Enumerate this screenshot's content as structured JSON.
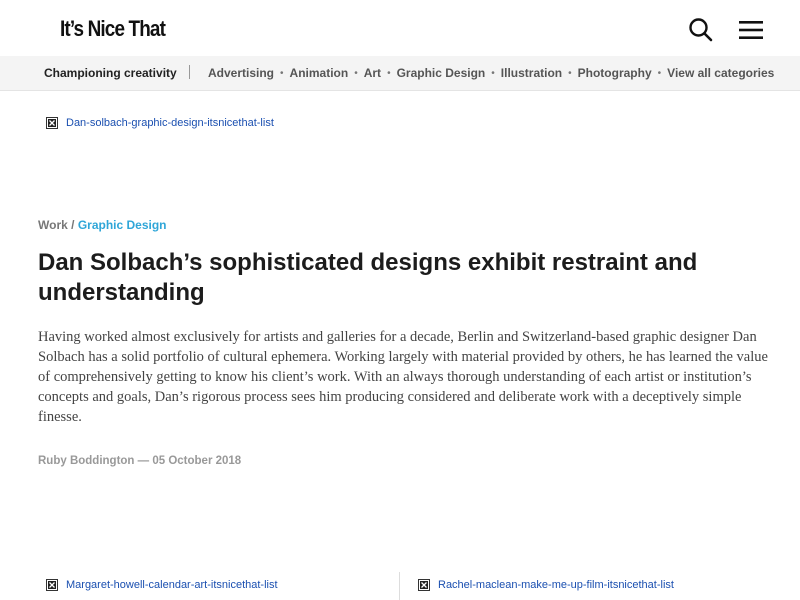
{
  "header": {
    "logo_text": "It’s Nice That",
    "search_icon": "search-icon",
    "menu_icon": "hamburger-menu-icon"
  },
  "nav": {
    "tagline": "Championing creativity",
    "categories": [
      "Advertising",
      "Animation",
      "Art",
      "Graphic Design",
      "Illustration",
      "Photography",
      "View all categories"
    ]
  },
  "hero_image": {
    "alt": "Dan-solbach-graphic-design-itsnicethat-list"
  },
  "article": {
    "breadcrumb_section": "Work",
    "breadcrumb_separator": " / ",
    "breadcrumb_category": "Graphic Design",
    "title": "Dan Solbach’s sophisticated designs exhibit restraint and understanding",
    "intro": "Having worked almost exclusively for artists and galleries for a decade, Berlin and Switzerland-based graphic designer Dan Solbach has a solid portfolio of cultural ephemera. Working largely with material provided by others, he has learned the value of comprehensively getting to know his client’s work. With an always thorough understanding of each artist or institution’s concepts and goals, Dan’s rigorous process sees him producing considered and deliberate work with a deceptively simple finesse.",
    "byline": "Ruby Boddington — 05 October 2018"
  },
  "related": [
    {
      "alt": "Margaret-howell-calendar-art-itsnicethat-list"
    },
    {
      "alt": "Rachel-maclean-make-me-up-film-itsnicethat-list"
    }
  ],
  "colors": {
    "link": "#1a4fb0",
    "accent": "#2fa6d8",
    "nav_bg": "#f4f4f4"
  }
}
